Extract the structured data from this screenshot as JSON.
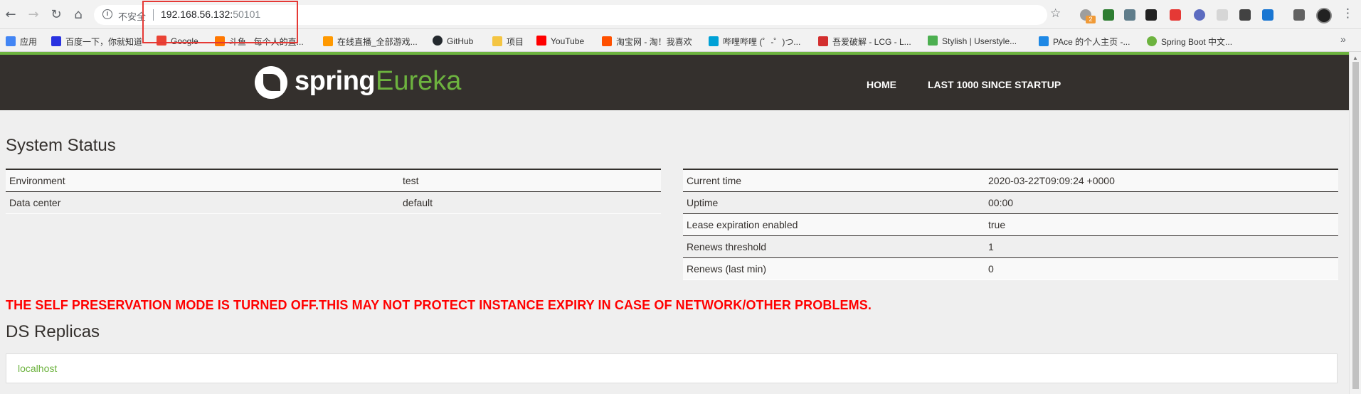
{
  "browser": {
    "insecure_label": "不安全",
    "url_host": "192.168.56.132:",
    "url_port": "50101",
    "bookmarks": [
      {
        "label": "应用",
        "color": "#4285f4"
      },
      {
        "label": "百度一下，你就知道",
        "color": "#2932e1"
      },
      {
        "label": "Google",
        "color": "#ea4335"
      },
      {
        "label": "斗鱼 - 每个人的直...",
        "color": "#ff7700"
      },
      {
        "label": "在线直播_全部游戏...",
        "color": "#ff9900"
      },
      {
        "label": "GitHub",
        "color": "#24292e"
      },
      {
        "label": "项目",
        "color": "#f4c542"
      },
      {
        "label": "YouTube",
        "color": "#ff0000"
      },
      {
        "label": "淘宝网 - 淘！我喜欢",
        "color": "#ff5000"
      },
      {
        "label": "哔哩哔哩 (゜-゜)つ...",
        "color": "#00a1d6"
      },
      {
        "label": "吾爱破解 - LCG - L...",
        "color": "#d32f2f"
      },
      {
        "label": "Stylish | Userstyle...",
        "color": "#4caf50"
      },
      {
        "label": "PAce 的个人主页 -...",
        "color": "#1e88e5"
      },
      {
        "label": "Spring Boot 中文...",
        "color": "#6db33f"
      }
    ],
    "extension_badge": "2"
  },
  "header": {
    "logo_word1": "spring",
    "logo_word2": "Eureka",
    "nav": [
      "HOME",
      "LAST 1000 SINCE STARTUP"
    ]
  },
  "system_status": {
    "title": "System Status",
    "left_table": [
      {
        "key": "Environment",
        "value": "test"
      },
      {
        "key": "Data center",
        "value": "default"
      }
    ],
    "right_table": [
      {
        "key": "Current time",
        "value": "2020-03-22T09:09:24 +0000"
      },
      {
        "key": "Uptime",
        "value": "00:00"
      },
      {
        "key": "Lease expiration enabled",
        "value": "true"
      },
      {
        "key": "Renews threshold",
        "value": "1"
      },
      {
        "key": "Renews (last min)",
        "value": "0"
      }
    ]
  },
  "warning": "THE SELF PRESERVATION MODE IS TURNED OFF.THIS MAY NOT PROTECT INSTANCE EXPIRY IN CASE OF NETWORK/OTHER PROBLEMS.",
  "ds_replicas": {
    "title": "DS Replicas",
    "items": [
      "localhost"
    ]
  }
}
